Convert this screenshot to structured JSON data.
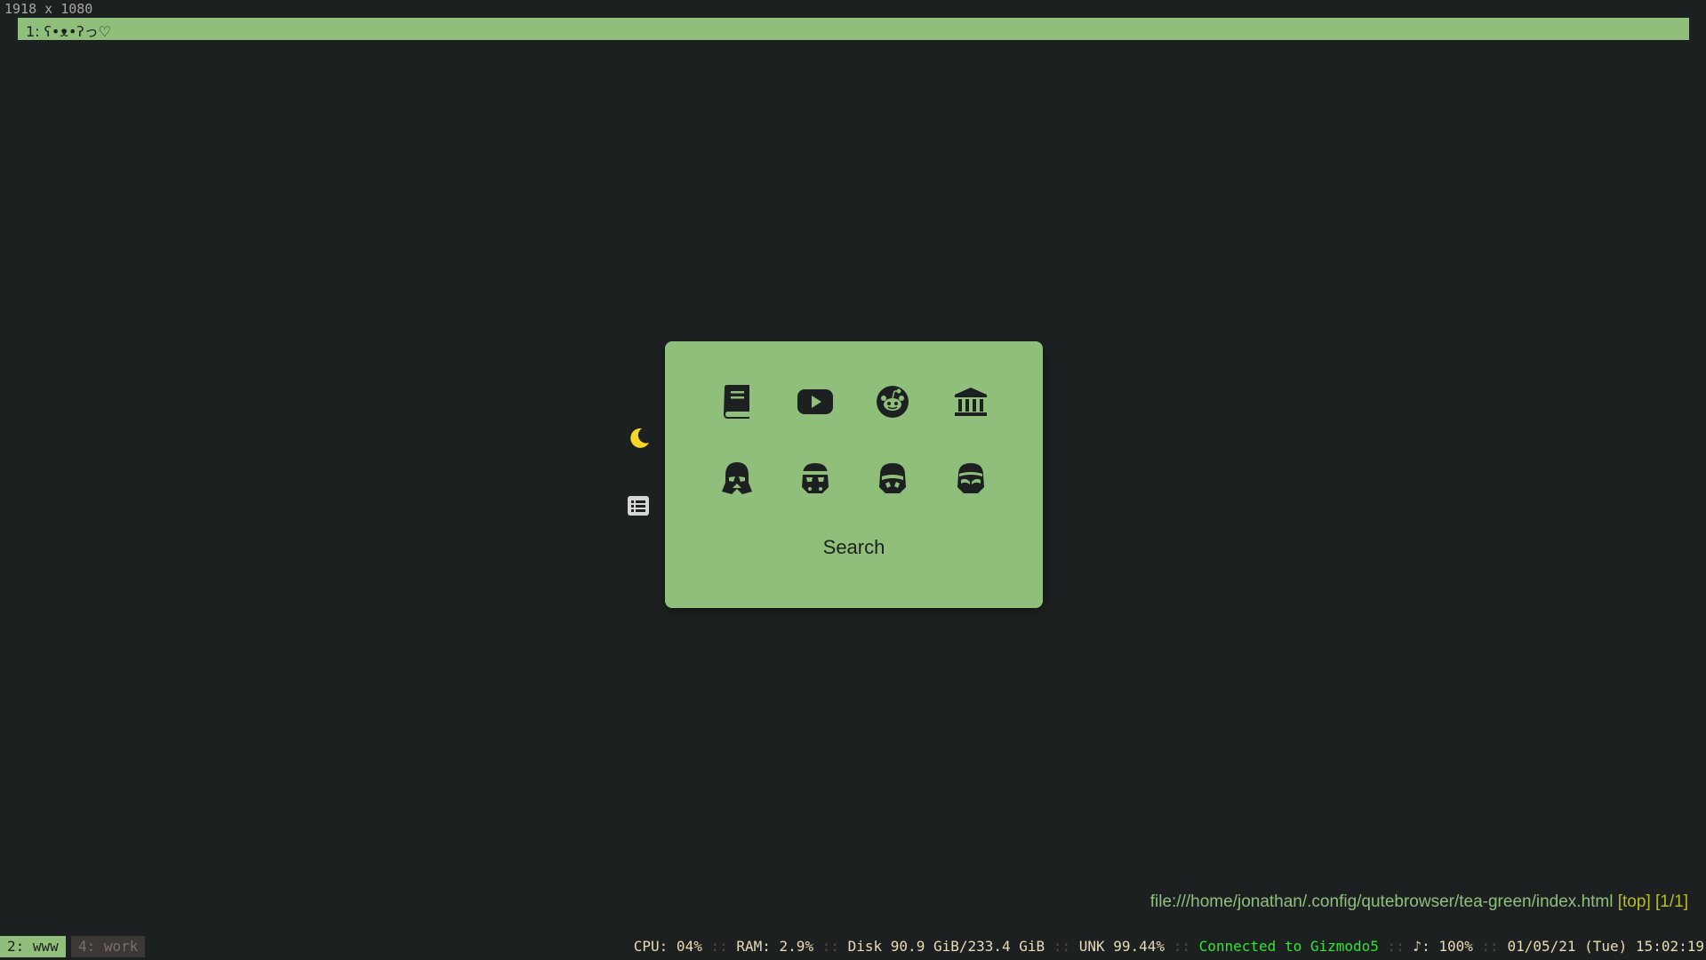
{
  "screen": {
    "dimensions_label": "1918 x 1080"
  },
  "browser": {
    "tab_title": "1: ʕ•ᴥ•ʔっ♡",
    "url": "file:///home/jonathan/.config/qutebrowser/tea-green/index.html",
    "scroll_position": "[top]",
    "tab_index": "[1/1]"
  },
  "sidebar": {
    "moon_icon": "moon-icon",
    "list_icon": "list-icon",
    "moon_color": "#f5d629"
  },
  "startpage": {
    "card_color": "#8fbf7a",
    "links_row1": [
      "book-icon",
      "youtube-icon",
      "reddit-icon",
      "bank-icon"
    ],
    "links_row2": [
      "darth-vader-icon",
      "stormtrooper-icon",
      "stormtrooper-icon",
      "stormtrooper-icon"
    ],
    "search_label": "Search"
  },
  "bar": {
    "workspace_active": "2: www",
    "workspace_inactive": "4: work",
    "cpu": "CPU: 04%",
    "ram": "RAM: 2.9%",
    "disk": "Disk 90.9 GiB/233.4 GiB",
    "unk": "UNK 99.44%",
    "network": "Connected to Gizmodo5",
    "volume": "♪: 100%",
    "datetime": "01/05/21 (Tue) 15:02:19",
    "separator": "::",
    "network_color": "#2ee62e"
  }
}
